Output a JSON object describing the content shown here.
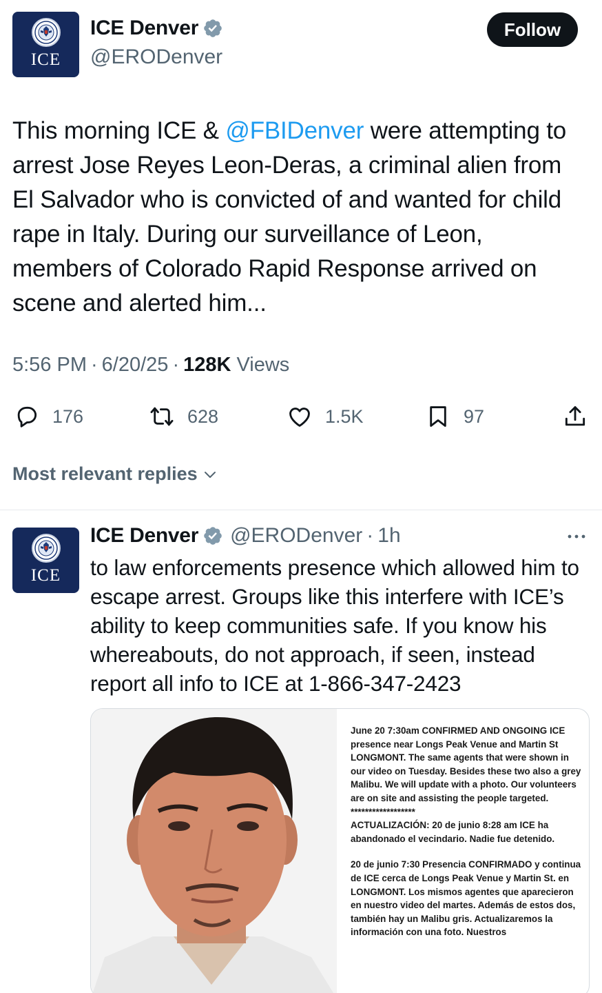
{
  "tweet": {
    "author": {
      "display_name": "ICE Denver",
      "handle": "@ERODenver",
      "avatar_text": "ICE",
      "verified_icon": "verified-badge-icon"
    },
    "follow_label": "Follow",
    "text_before": "This morning ICE & ",
    "mention": "@FBIDenver",
    "text_after": " were attempting to arrest Jose Reyes Leon-Deras, a criminal alien from El Salvador who is convicted of and wanted for child rape in Italy. During our surveillance of Leon, members of Colorado Rapid Response arrived on scene and alerted him...",
    "time": "5:56 PM",
    "dot1": "·",
    "date": "6/20/25",
    "dot2": "·",
    "views_count": "128K",
    "views_label": "Views",
    "actions": {
      "replies": "176",
      "reposts": "628",
      "likes": "1.5K",
      "bookmarks": "97"
    }
  },
  "replies_sort_label": "Most relevant replies",
  "reply": {
    "display_name": "ICE Denver",
    "handle": "@ERODenver",
    "dot": "·",
    "age": "1h",
    "avatar_text": "ICE",
    "text": "to law enforcements presence which allowed him to escape arrest. Groups like this interfere with ICE’s ability to keep communities safe. If you know his whereabouts, do not approach, if seen, instead report all info to ICE at 1-866-347-2423",
    "media_lines": {
      "p1": "June 20 7:30am CONFIRMED AND ONGOING ICE presence near Longs Peak Venue and Martin St LONGMONT. The same agents that were shown in our video on Tuesday. Besides these two also a grey Malibu. We will update with a photo. Our volunteers are on site and assisting the people targeted.",
      "stars": "******************",
      "p2": "ACTUALIZACIÓN: 20 de junio 8:28 am ICE ha abandonado el vecindario. Nadie fue detenido.",
      "p3": "20 de junio 7:30 Presencia CONFIRMADO y continua de ICE cerca de Longs Peak Venue y Martin St. en LONGMONT. Los mismos agentes que aparecieron en nuestro video del martes. Además de estos dos, también hay un Malibu gris. Actualizaremos la información con una foto. Nuestros"
    }
  },
  "colors": {
    "link": "#1d9bf0",
    "secondary_text": "#536471",
    "primary_text": "#0f1419",
    "avatar_bg": "#15295b",
    "verified": "#829aab"
  }
}
